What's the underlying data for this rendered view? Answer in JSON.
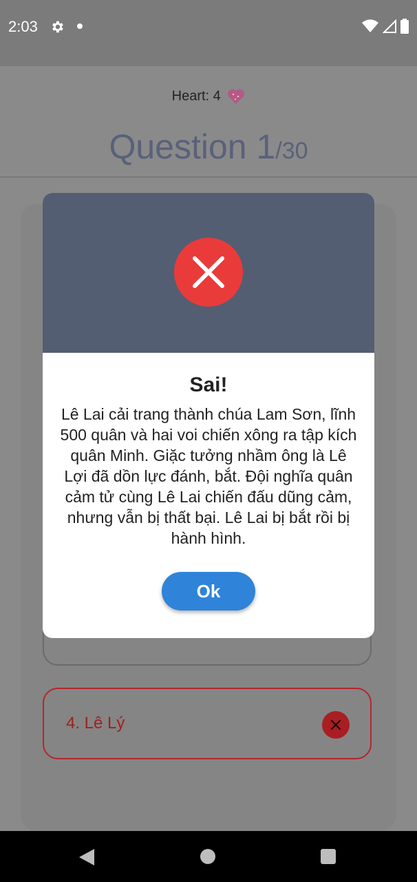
{
  "status_bar": {
    "time": "2:03",
    "icons": [
      "gear-icon",
      "notification-dot-icon",
      "wifi-icon",
      "signal-icon",
      "battery-icon"
    ]
  },
  "quiz": {
    "heart_label": "Heart: 4",
    "heart_icon": "sparkling-heart-icon",
    "question_label": "Question 1",
    "question_total": "/30",
    "options": [
      {
        "label": "4. Lê Lý",
        "state": "wrong"
      }
    ]
  },
  "dialog": {
    "icon": "error-x-icon",
    "title": "Sai!",
    "message": "Lê Lai cải trang thành chúa Lam Sơn, lĩnh 500 quân và hai voi chiến xông ra tập kích quân Minh. Giặc tưởng nhầm ông là Lê Lợi đã dồn lực đánh, bắt. Đội nghĩa quân cảm tử cùng Lê Lai chiến đấu dũng cảm, nhưng vẫn bị thất bại. Lê Lai bị bắt rồi bị hành hình.",
    "ok_label": "Ok"
  },
  "colors": {
    "dialog_header": "#535e72",
    "error_red": "#ea3b3b",
    "ok_button": "#2f83d9",
    "wrong_option": "#a81e22"
  }
}
